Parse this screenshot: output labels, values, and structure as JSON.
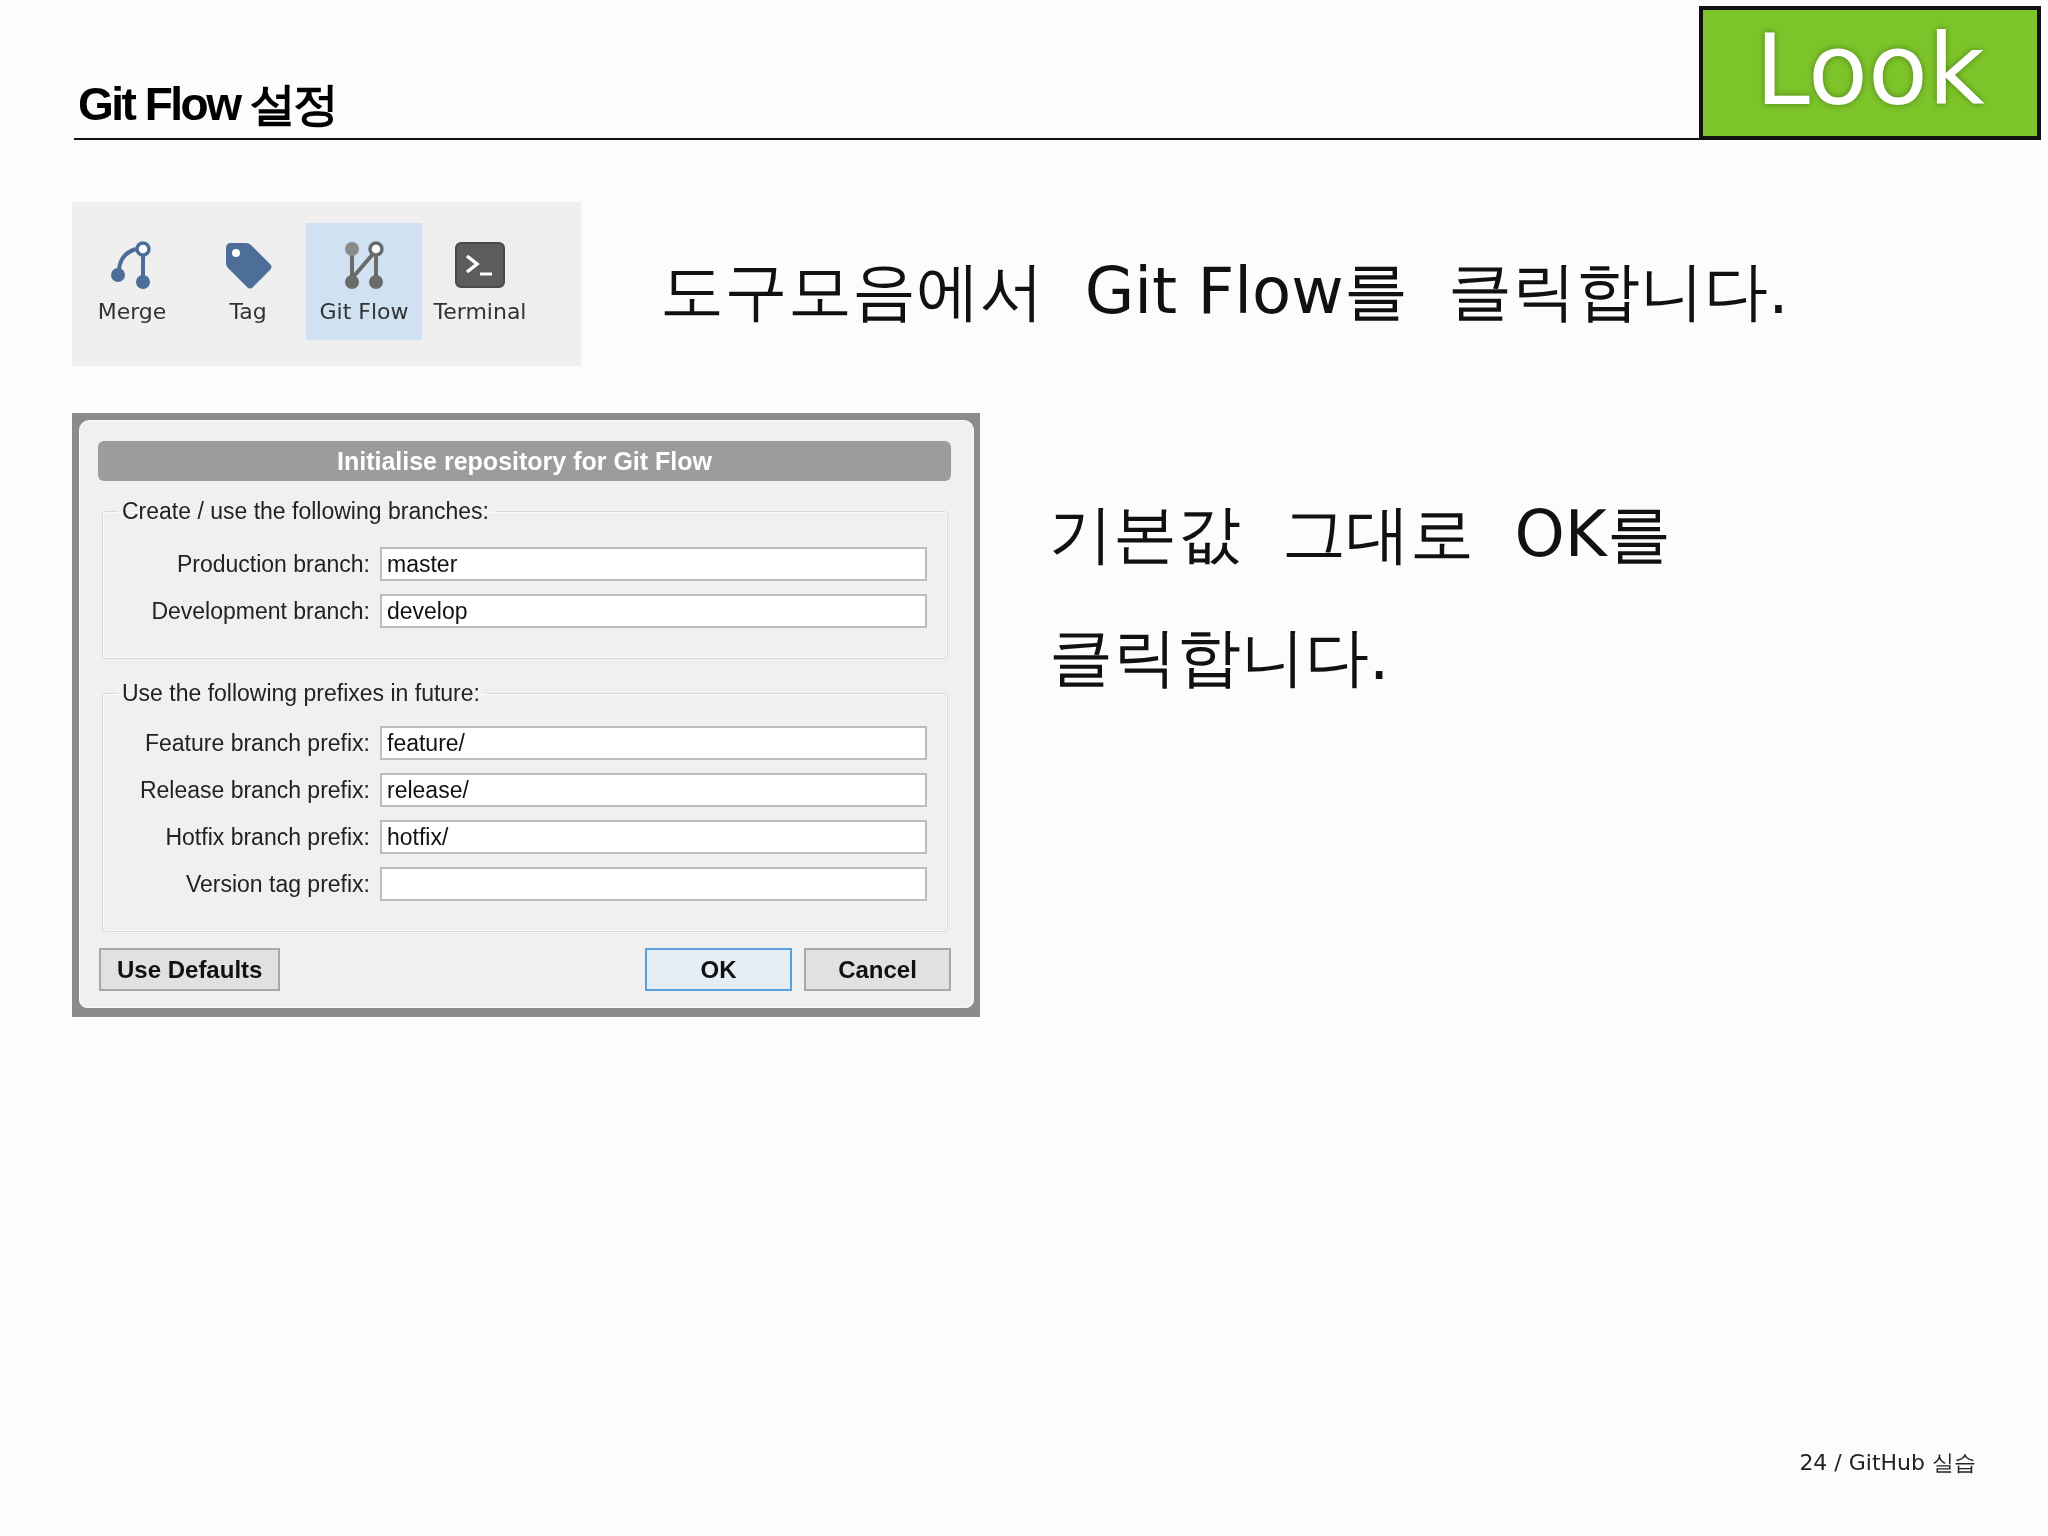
{
  "slide": {
    "title": "Git Flow 설정",
    "badge": "Look"
  },
  "toolbar": {
    "items": [
      {
        "label": "Merge",
        "selected": false
      },
      {
        "label": "Tag",
        "selected": false
      },
      {
        "label": "Git Flow",
        "selected": true
      },
      {
        "label": "Terminal",
        "selected": false
      }
    ]
  },
  "toolbar_instruction": "도구모음에서  Git Flow를  클릭합니다.",
  "dialog": {
    "title": "Initialise repository for Git Flow",
    "groups": [
      {
        "legend": "Create / use the following branches:",
        "fields": [
          {
            "label": "Production branch:",
            "value": "master"
          },
          {
            "label": "Development branch:",
            "value": "develop"
          }
        ]
      },
      {
        "legend": "Use the following prefixes in future:",
        "fields": [
          {
            "label": "Feature branch prefix:",
            "value": "feature/"
          },
          {
            "label": "Release branch prefix:",
            "value": "release/"
          },
          {
            "label": "Hotfix branch prefix:",
            "value": "hotfix/"
          },
          {
            "label": "Version tag prefix:"
          }
        ]
      }
    ],
    "buttons_left": [
      {
        "label": "Use Defaults",
        "default": false
      }
    ],
    "buttons_right": [
      {
        "label": "OK",
        "default": true
      },
      {
        "label": "Cancel",
        "default": false
      }
    ]
  },
  "dialog_instruction": "기본값  그대로  OK를\n클릭합니다.",
  "footer": "24 / GitHub 실습"
}
